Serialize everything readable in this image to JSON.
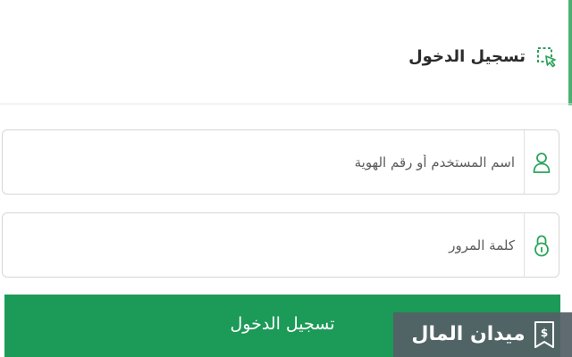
{
  "header": {
    "title": "تسجيل الدخول",
    "icon": "cursor-select-icon"
  },
  "form": {
    "username": {
      "placeholder": "اسم المستخدم أو رقم الهوية",
      "value": "",
      "icon": "user-icon"
    },
    "password": {
      "placeholder": "كلمة المرور",
      "value": "",
      "icon": "lock-icon"
    },
    "submit_label": "تسجيل الدخول"
  },
  "watermark": {
    "text": "ميدان المال",
    "logo_text": "$"
  },
  "colors": {
    "accent": "#1c9a57",
    "icon_green": "#2aa35a",
    "watermark_bg": "#546066"
  }
}
